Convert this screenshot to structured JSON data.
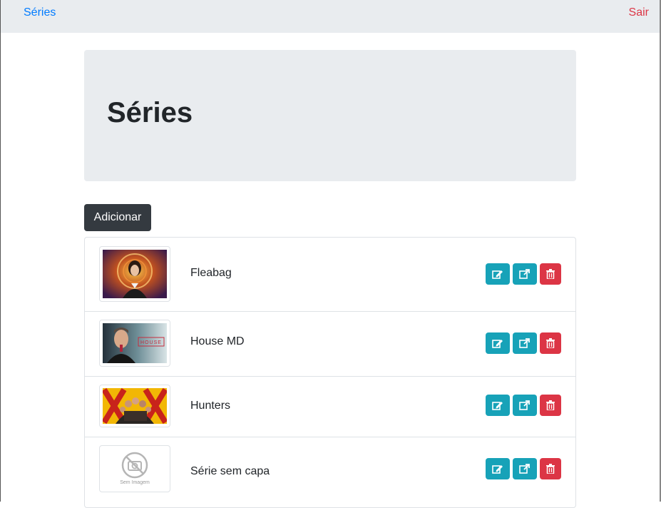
{
  "navbar": {
    "brand": "Séries",
    "logout": "Sair"
  },
  "jumbotron": {
    "title": "Séries"
  },
  "add_button": "Adicionar",
  "series": [
    {
      "title": "Fleabag"
    },
    {
      "title": "House MD",
      "poster_text": "HOUSE"
    },
    {
      "title": "Hunters"
    },
    {
      "title": "Série sem capa",
      "placeholder_caption": "Sem Imagem"
    }
  ],
  "colors": {
    "primary": "#007bff",
    "danger": "#dc3545",
    "info": "#17a2b8",
    "dark": "#343a40",
    "light": "#e9ecef"
  },
  "icons": {
    "edit": "edit-icon",
    "open": "external-link-icon",
    "delete": "trash-icon",
    "no_image": "no-camera-icon"
  }
}
